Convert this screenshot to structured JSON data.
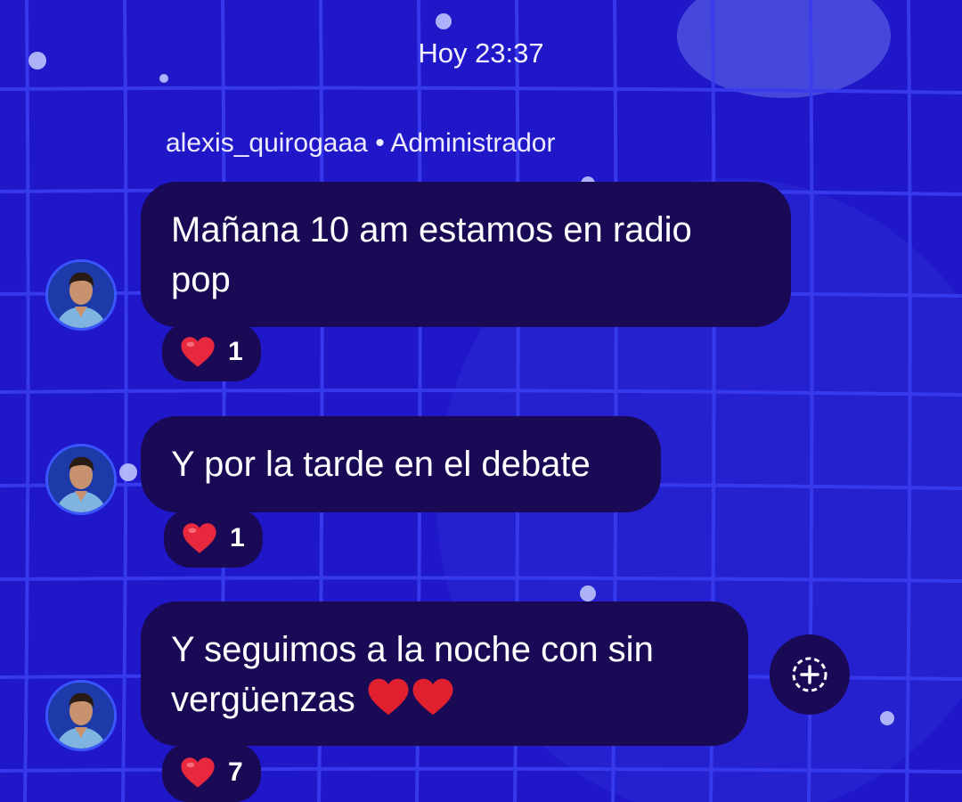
{
  "header": {
    "timestamp": "Hoy 23:37"
  },
  "sender": {
    "name": "alexis_quirogaaa",
    "separator": "•",
    "role": "Administrador"
  },
  "messages": [
    {
      "line1": "Mañana 10 am estamos en radio",
      "line2": "pop",
      "reaction_count": "1"
    },
    {
      "line1": "Y por la tarde en el debate",
      "reaction_count": "1"
    },
    {
      "line1": "Y seguimos a la noche con sin",
      "line2": "vergüenzas",
      "reaction_count": "7"
    }
  ],
  "icons": {
    "reaction": "red-heart-icon",
    "add_reaction": "add-reaction-icon",
    "avatar": "user-avatar"
  },
  "colors": {
    "background": "#1f17c8",
    "bubble": "#1a0a55",
    "heart": "#e8283c",
    "text": "#ffffff"
  }
}
